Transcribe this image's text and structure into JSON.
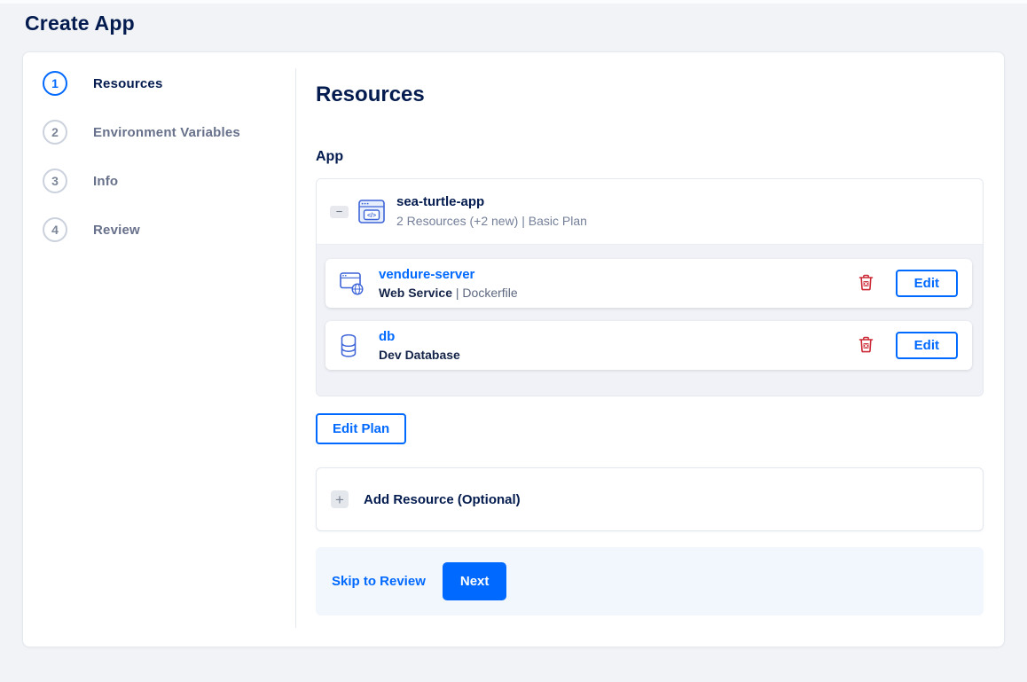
{
  "page": {
    "title": "Create App"
  },
  "steps": [
    {
      "number": "1",
      "label": "Resources",
      "active": true
    },
    {
      "number": "2",
      "label": "Environment Variables",
      "active": false
    },
    {
      "number": "3",
      "label": "Info",
      "active": false
    },
    {
      "number": "4",
      "label": "Review",
      "active": false
    }
  ],
  "content": {
    "heading": "Resources",
    "section_label": "App",
    "app": {
      "collapse_glyph": "−",
      "icon_glyph": "</>",
      "name": "sea-turtle-app",
      "summary": "2 Resources (+2 new) | Basic Plan",
      "resources": [
        {
          "icon": "web-service-icon",
          "name": "vendure-server",
          "type": "Web Service",
          "suffix": " | Dockerfile",
          "edit_label": "Edit"
        },
        {
          "icon": "database-icon",
          "name": "db",
          "type": "Dev Database",
          "suffix": "",
          "edit_label": "Edit"
        }
      ]
    },
    "edit_plan_label": "Edit Plan",
    "add_resource": {
      "plus_glyph": "+",
      "label": "Add Resource (Optional)"
    },
    "footer": {
      "skip_label": "Skip to Review",
      "next_label": "Next"
    }
  },
  "colors": {
    "accent": "#0069ff",
    "navy": "#031b4e",
    "muted": "#747f99",
    "danger": "#cc2936",
    "icon": "#3d64d8",
    "page-bg": "#f1f3f6",
    "footer-bg": "#f2f6fd"
  }
}
